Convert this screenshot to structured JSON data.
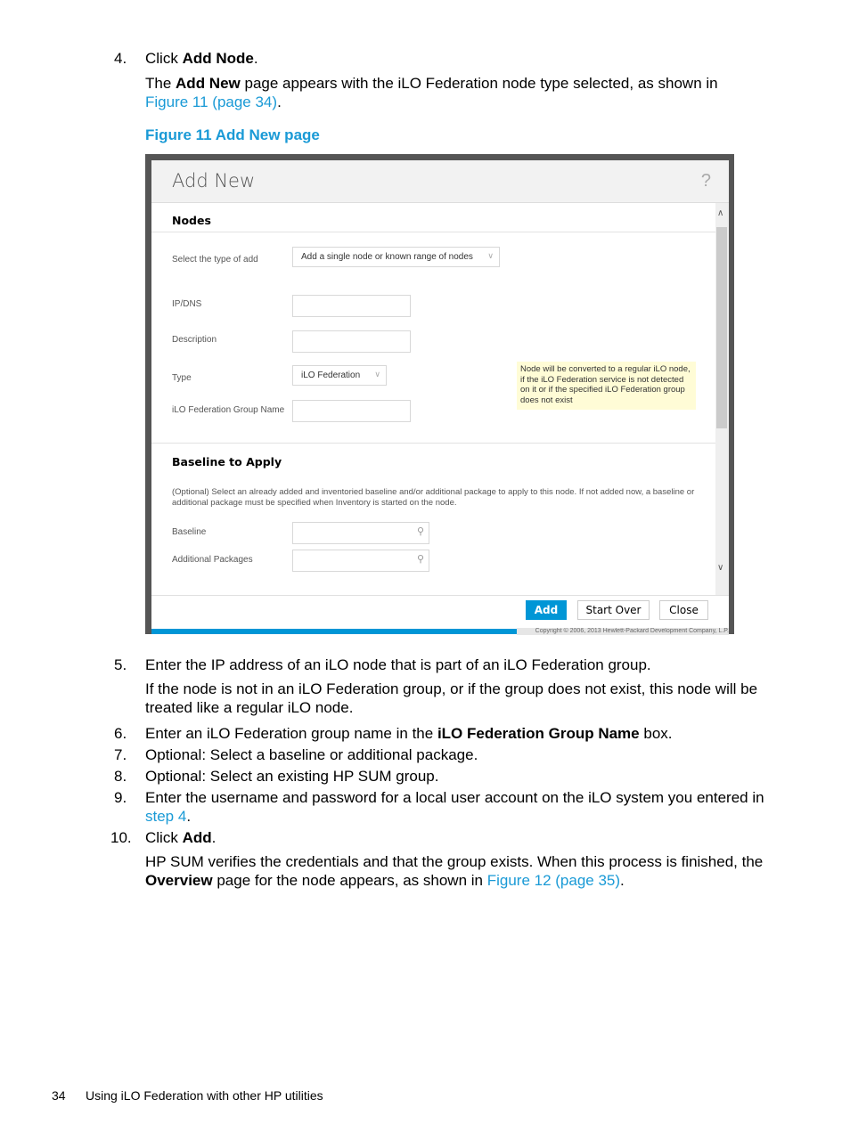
{
  "steps_top": {
    "step4": {
      "num": "4.",
      "pre": "Click ",
      "bold": "Add Node",
      "post": "."
    },
    "step4_para": {
      "pre": "The ",
      "bold": "Add New",
      "mid": " page appears with the iLO Federation node type selected, as shown in",
      "link": "Figure 11 (page 34)",
      "post": "."
    }
  },
  "figure_caption": "Figure 11 Add New page",
  "dialog": {
    "title": "Add New",
    "help_icon": "?",
    "nodes_section": "Nodes",
    "select_type_label": "Select the type of add",
    "select_type_value": "Add a single node or known range of nodes",
    "ipdns_label": "IP/DNS",
    "description_label": "Description",
    "type_label": "Type",
    "type_value": "iLO Federation",
    "group_name_label": "iLO Federation Group Name",
    "note_text": "Node will be converted to a regular iLO node, if the iLO Federation service is not detected on it or if the specified iLO Federation group does not exist",
    "baseline_section": "Baseline to Apply",
    "baseline_desc": "(Optional) Select an already added and inventoried baseline and/or additional package to apply to this node. If not added now, a baseline or additional package must be specified when Inventory is started on the node.",
    "baseline_label": "Baseline",
    "packages_label": "Additional Packages",
    "buttons": {
      "add": "Add",
      "start_over": "Start Over",
      "close": "Close"
    },
    "copyright": "Copyright © 2006, 2013 Hewlett-Packard Development Company, L.P.",
    "accent_color": "#0096d6"
  },
  "steps_bottom": {
    "s5": {
      "num": "5.",
      "text": "Enter the IP address of an iLO node that is part of an iLO Federation group."
    },
    "s5_para": "If the node is not in an iLO Federation group, or if the group does not exist, this node will be treated like a regular iLO node.",
    "s6": {
      "num": "6.",
      "pre": "Enter an iLO Federation group name in the ",
      "bold": "iLO Federation Group Name",
      "post": " box."
    },
    "s7": {
      "num": "7.",
      "text": "Optional: Select a baseline or additional package."
    },
    "s8": {
      "num": "8.",
      "text": "Optional: Select an existing HP SUM group."
    },
    "s9": {
      "num": "9.",
      "text": "Enter the username and password for a local user account on the iLO system you entered in",
      "link": "step 4",
      "post": "."
    },
    "s10": {
      "num": "10.",
      "pre": "Click ",
      "bold": "Add",
      "post": "."
    },
    "s10_para": {
      "pre": "HP SUM verifies the credentials and that the group exists. When this process is finished, the ",
      "bold": "Overview",
      "mid": " page for the node appears, as shown in ",
      "link": "Figure 12 (page 35)",
      "post": "."
    }
  },
  "footer": {
    "page_number": "34",
    "section": "Using iLO Federation with other HP utilities"
  },
  "link_color": "#1a9ad6"
}
